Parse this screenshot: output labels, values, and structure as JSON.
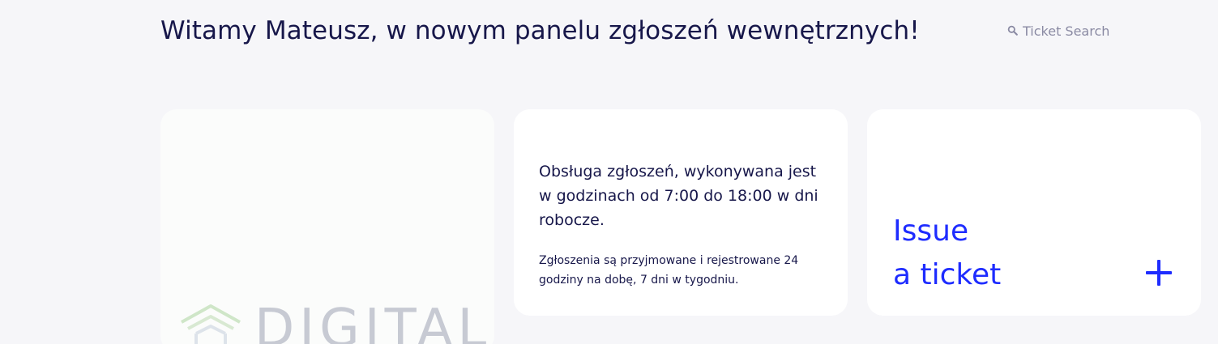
{
  "header": {
    "welcome": "Witamy Mateusz, w nowym panelu zgłoszeń wewnętrznych!",
    "search_placeholder": "Ticket Search",
    "search_icon": "search-icon"
  },
  "cards": {
    "logo": {
      "text": "DIGITAL",
      "icon": "house-shield-logo-icon"
    },
    "hours": {
      "main": "Obsługa zgłoszeń, wykonywana jest w godzinach od 7:00 do 18:00 w dni robocze.",
      "sub": "Zgłoszenia są przyjmowane i rejestrowane 24 godziny na dobę, 7 dni w tygodniu."
    },
    "issue": {
      "line1": "Issue",
      "line2": "a ticket",
      "icon": "plus-icon"
    }
  },
  "colors": {
    "background": "#f6f6f9",
    "text": "#17174a",
    "accent": "#1e2cff",
    "muted": "#8a8aa3"
  }
}
